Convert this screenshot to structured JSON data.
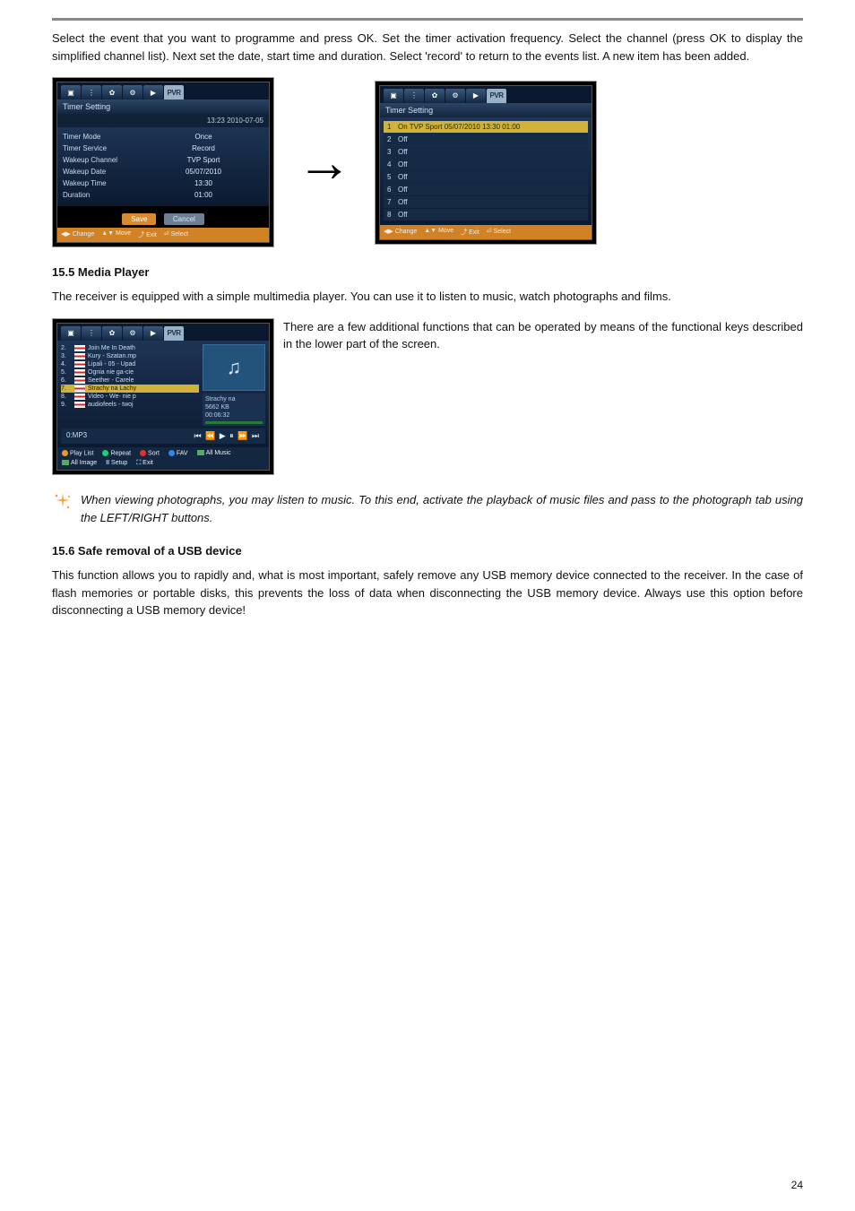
{
  "intro_paragraph": "Select the event that you want to programme and press OK. Set the timer activation frequency. Select the channel (press OK to display the simplified channel list). Next set the date, start time and duration. Select 'record' to return to the events list. A new item has been added.",
  "screenshot_left": {
    "pvr_label": "PVR",
    "title": "Timer Setting",
    "timestamp": "13:23 2010-07-05",
    "rows": [
      {
        "label": "Timer Mode",
        "value": "Once"
      },
      {
        "label": "Timer Service",
        "value": "Record"
      },
      {
        "label": "Wakeup Channel",
        "value": "TVP Sport"
      },
      {
        "label": "Wakeup Date",
        "value": "05/07/2010"
      },
      {
        "label": "Wakeup Time",
        "value": "13:30"
      },
      {
        "label": "Duration",
        "value": "01:00"
      }
    ],
    "save": "Save",
    "cancel": "Cancel",
    "legend": [
      "◀▶ Change",
      "▲▼ Move",
      "⤴ Exit",
      "⏎ Select"
    ]
  },
  "screenshot_right": {
    "pvr_label": "PVR",
    "title": "Timer Setting",
    "rows": [
      {
        "n": "1",
        "text": "On  TVP Sport   05/07/2010 13:30  01:00"
      },
      {
        "n": "2",
        "text": "Off"
      },
      {
        "n": "3",
        "text": "Off"
      },
      {
        "n": "4",
        "text": "Off"
      },
      {
        "n": "5",
        "text": "Off"
      },
      {
        "n": "6",
        "text": "Off"
      },
      {
        "n": "7",
        "text": "Off"
      },
      {
        "n": "8",
        "text": "Off"
      }
    ],
    "legend": [
      "◀▶ Change",
      "▲▼ Move",
      "⤴ Exit",
      "⏎ Select"
    ]
  },
  "section_15_5_title": "15.5 Media Player",
  "section_15_5_p1": "The receiver is equipped with a simple multimedia player. You can use it to listen to music, watch photographs and films.",
  "section_15_5_p2": "There are a few additional functions that can be operated by means of the functional keys described in the lower part of the screen.",
  "media_screenshot": {
    "pvr_label": "PVR",
    "items": [
      {
        "n": "2.",
        "t": "Join Me In Death"
      },
      {
        "n": "3.",
        "t": "Kury - Szatan.mp"
      },
      {
        "n": "4.",
        "t": "Lipali - 05 - Upad"
      },
      {
        "n": "5.",
        "t": "Ognia nie ga-cie"
      },
      {
        "n": "6.",
        "t": "Seether - Carele"
      },
      {
        "n": "7.",
        "t": "Strachy na Lachy"
      },
      {
        "n": "8.",
        "t": "Video - We- nie p"
      },
      {
        "n": "9.",
        "t": "audiofeels - twoj"
      }
    ],
    "info_title": "Strachy na",
    "info_size": "5662 KB",
    "info_time": "00:06:32",
    "folder": "0:MP3",
    "transport": "⏮ ⏪ ▶ ⏸ ⏩ ⏭",
    "legend": [
      {
        "c": "o",
        "t": "Play List"
      },
      {
        "c": "g",
        "t": "Repeat"
      },
      {
        "c": "r",
        "t": "Sort"
      },
      {
        "c": "b",
        "t": "FAV"
      },
      {
        "s": true,
        "t": "All  Music"
      },
      {
        "s": true,
        "t": "All Image"
      },
      {
        "p": "II",
        "t": "Setup"
      },
      {
        "p": "⛶",
        "t": "Exit"
      }
    ]
  },
  "note_text": "When viewing photographs, you may listen to music. To this end, activate the playback of music files and pass to the photograph tab using the LEFT/RIGHT buttons.",
  "section_15_6_title": "15.6 Safe removal of a USB device",
  "section_15_6_p": "This function allows you to rapidly and, what is most important, safely remove any USB memory device connected to the receiver. In the case of flash memories or portable disks, this prevents the loss of data when disconnecting the USB memory device. Always use this option before disconnecting a USB memory device!",
  "page_number": "24"
}
